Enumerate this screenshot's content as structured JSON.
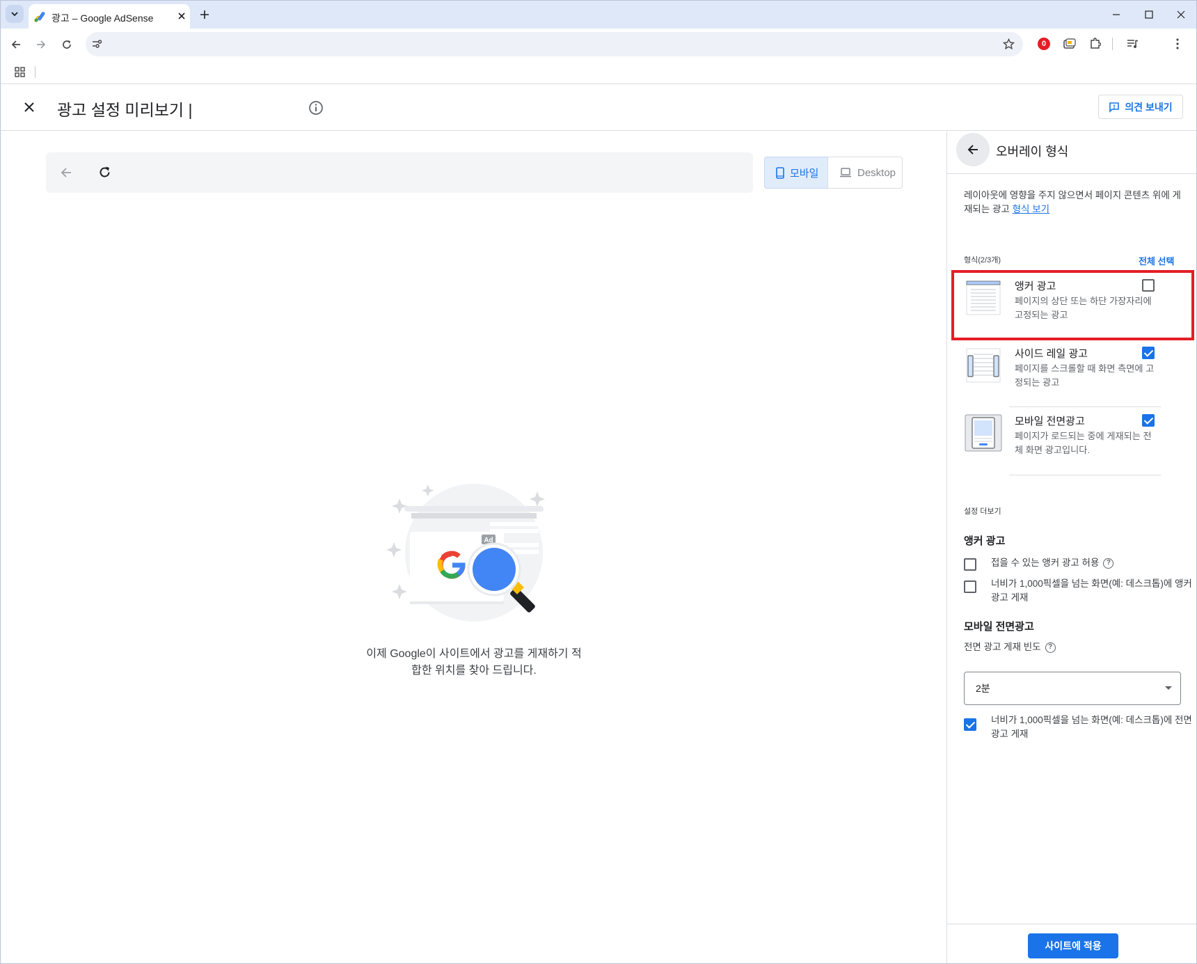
{
  "browser": {
    "tab_title": "광고 – Google AdSense",
    "url": ""
  },
  "header": {
    "title": "광고 설정 미리보기 |",
    "feedback_label": "의견 보내기"
  },
  "preview": {
    "device_mobile_label": "모바일",
    "device_desktop_label": "Desktop",
    "ad_badge": "Ad",
    "caption_line1": "이제 Google이 사이트에서 광고를 게재하기 적",
    "caption_line2": "합한 위치를 찾아 드립니다."
  },
  "panel": {
    "title": "오버레이 형식",
    "description": "레이아웃에 영향을 주지 않으면서 페이지 콘텐츠 위에 게재되는 광고",
    "description_link": "형식 보기",
    "formats_label": "형식(2/3개)",
    "select_all": "전체 선택",
    "formats": [
      {
        "title": "앵커 광고",
        "desc": "페이지의 상단 또는 하단 가장자리에 고정되는 광고",
        "checked": false
      },
      {
        "title": "사이드 레일 광고",
        "desc": "페이지를 스크롤할 때 화면 측면에 고정되는 광고",
        "checked": true
      },
      {
        "title": "모바일 전면광고",
        "desc": "페이지가 로드되는 중에 게재되는 전체 화면 광고입니다.",
        "checked": true
      }
    ],
    "more_settings": "설정 더보기",
    "anchor": {
      "heading": "앵커 광고",
      "opt1": "접을 수 있는 앵커 광고 허용",
      "opt2": "너비가 1,000픽셀을 넘는 화면(예: 데스크톱)에 앵커 광고 게재",
      "opt1_checked": false,
      "opt2_checked": false
    },
    "vignette": {
      "heading": "모바일 전면광고",
      "freq_label": "전면 광고 게재 빈도",
      "freq_value": "2분",
      "opt": "너비가 1,000픽셀을 넘는 화면(예: 데스크톱)에 전면 광고 게재",
      "opt_checked": true
    },
    "apply_label": "사이트에 적용"
  },
  "colors": {
    "accent": "#1a73e8",
    "highlight": "#e41e26"
  }
}
